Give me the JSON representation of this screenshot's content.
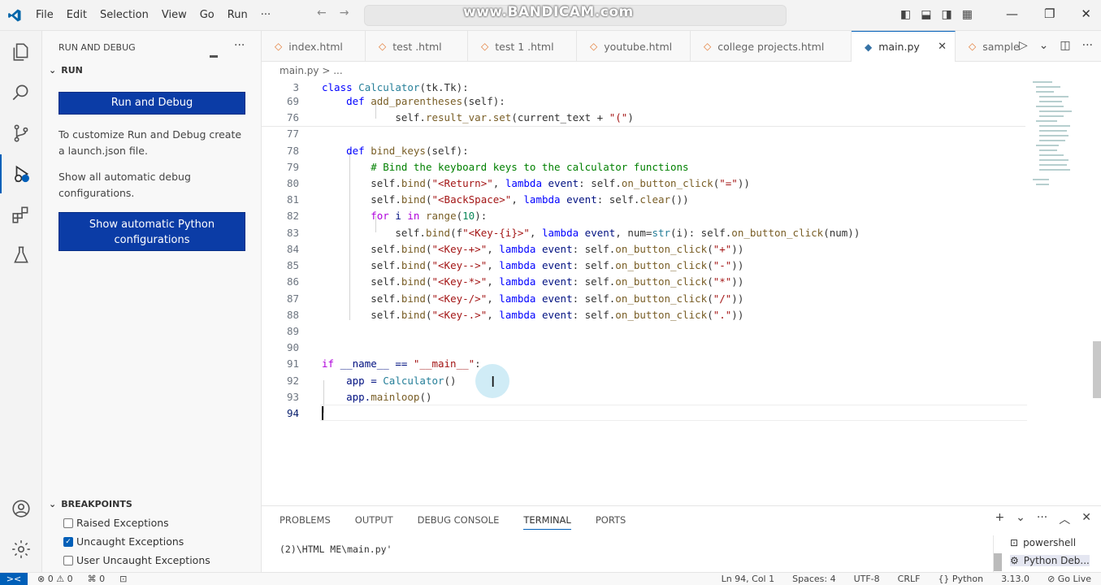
{
  "titlebar": {
    "menu": [
      "File",
      "Edit",
      "Selection",
      "View",
      "Go",
      "Run",
      "···"
    ],
    "watermark": "www.BANDICAM.com"
  },
  "sidebar": {
    "header": "RUN AND DEBUG",
    "more": "···",
    "run_section": "RUN",
    "run_debug_button": "Run and Debug",
    "customize_text": "To customize Run and Debug create a launch.json file.",
    "show_configs_text": "Show all automatic debug configurations.",
    "python_button": "Show automatic Python configurations",
    "breakpoints_header": "BREAKPOINTS",
    "breakpoints": [
      {
        "label": "Raised Exceptions",
        "checked": false
      },
      {
        "label": "Uncaught Exceptions",
        "checked": true
      },
      {
        "label": "User Uncaught Exceptions",
        "checked": false
      }
    ]
  },
  "tabs": [
    {
      "label": "index.html",
      "active": false
    },
    {
      "label": "test .html",
      "active": false
    },
    {
      "label": "test 1 .html",
      "active": false
    },
    {
      "label": "youtube.html",
      "active": false
    },
    {
      "label": "college projects.html",
      "active": false
    },
    {
      "label": "main.py",
      "active": true
    },
    {
      "label": "sample",
      "active": false
    }
  ],
  "breadcrumb": "main.py > ...",
  "editor": {
    "lines": [
      {
        "n": "3"
      },
      {
        "n": "69"
      },
      {
        "n": "76"
      },
      {
        "n": "77"
      },
      {
        "n": "78"
      },
      {
        "n": "79"
      },
      {
        "n": "80"
      },
      {
        "n": "81"
      },
      {
        "n": "82"
      },
      {
        "n": "83"
      },
      {
        "n": "84"
      },
      {
        "n": "85"
      },
      {
        "n": "86"
      },
      {
        "n": "87"
      },
      {
        "n": "88"
      },
      {
        "n": "89"
      },
      {
        "n": "90"
      },
      {
        "n": "91"
      },
      {
        "n": "92"
      },
      {
        "n": "93"
      },
      {
        "n": "94"
      }
    ],
    "code": {
      "l3_kw": "class",
      "l3_cls": "Calculator",
      "l3_rest": "(tk.Tk):",
      "l69_kw": "def",
      "l69_fn": "add_parentheses",
      "l69_rest": "(self):",
      "l76_a": "self.",
      "l76_fn": "result_var.set",
      "l76_b": "(current_text + ",
      "l76_str": "\"(\"",
      "l76_c": ")",
      "l78_kw": "def",
      "l78_fn": "bind_keys",
      "l78_rest": "(self):",
      "l79_cm": "# Bind the keyboard keys to the calculator functions",
      "l80_a": "self.",
      "l80_fn": "bind",
      "l80_b": "(",
      "l80_str": "\"<Return>\"",
      "l80_c": ", ",
      "l80_kw": "lambda",
      "l80_prm": " event",
      "l80_d": ": self.",
      "l80_fn2": "on_button_click",
      "l80_e": "(",
      "l80_str2": "\"=\"",
      "l80_f": "))",
      "l81_a": "self.",
      "l81_fn": "bind",
      "l81_b": "(",
      "l81_str": "\"<BackSpace>\"",
      "l81_c": ", ",
      "l81_kw": "lambda",
      "l81_prm": " event",
      "l81_d": ": self.",
      "l81_fn2": "clear",
      "l81_e": "())",
      "l82_ctl": "for",
      "l82_a": " i ",
      "l82_ctl2": "in",
      "l82_fn": " range",
      "l82_b": "(",
      "l82_num": "10",
      "l82_c": "):",
      "l83_a": "self.",
      "l83_fn": "bind",
      "l83_b": "(f",
      "l83_str": "\"<Key-{i}>\"",
      "l83_c": ", ",
      "l83_kw": "lambda",
      "l83_prm": " event",
      "l83_d": ", num=",
      "l83_fn3": "str",
      "l83_e": "(i): self.",
      "l83_fn2": "on_button_click",
      "l83_f": "(num))",
      "l84_str": "\"<Key-+>\"",
      "l84_str2": "\"+\"",
      "l85_str": "\"<Key-->\"",
      "l85_str2": "\"-\"",
      "l86_str": "\"<Key-*>\"",
      "l86_str2": "\"*\"",
      "l87_str": "\"<Key-/>\"",
      "l87_str2": "\"/\"",
      "l88_str": "\"<Key-.>\"",
      "l88_str2": "\".\"",
      "bind_self": "self.",
      "bind_fn": "bind",
      "bind_open": "(",
      "bind_comma": ", ",
      "bind_lambda": "lambda",
      "bind_event": " event",
      "bind_colon": ": self.",
      "bind_click": "on_button_click",
      "bind_paren": "(",
      "bind_close": "))",
      "l91_ctl": "if",
      "l91_a": " __name__ == ",
      "l91_str": "\"__main__\"",
      "l91_b": ":",
      "l92_a": "app = ",
      "l92_cls": "Calculator",
      "l92_b": "()",
      "l93_a": "app.",
      "l93_fn": "mainloop",
      "l93_b": "()"
    }
  },
  "panel": {
    "tabs": [
      "PROBLEMS",
      "OUTPUT",
      "DEBUG CONSOLE",
      "TERMINAL",
      "PORTS"
    ],
    "active_tab": "TERMINAL",
    "terminal_text": "(2)\\HTML ME\\main.py'",
    "terminals": [
      "powershell",
      "Python Deb..."
    ]
  },
  "statusbar": {
    "remote": "><",
    "left": [
      "⊗ 0 ⚠ 0",
      "⌘ 0",
      "⊡"
    ],
    "right": [
      "Ln 94, Col 1",
      "Spaces: 4",
      "UTF-8",
      "CRLF",
      "{} Python",
      "3.13.0",
      "⊘ Go Live"
    ]
  },
  "colors": {
    "accent": "#005fb8",
    "primary_button": "#0b3ca6"
  }
}
